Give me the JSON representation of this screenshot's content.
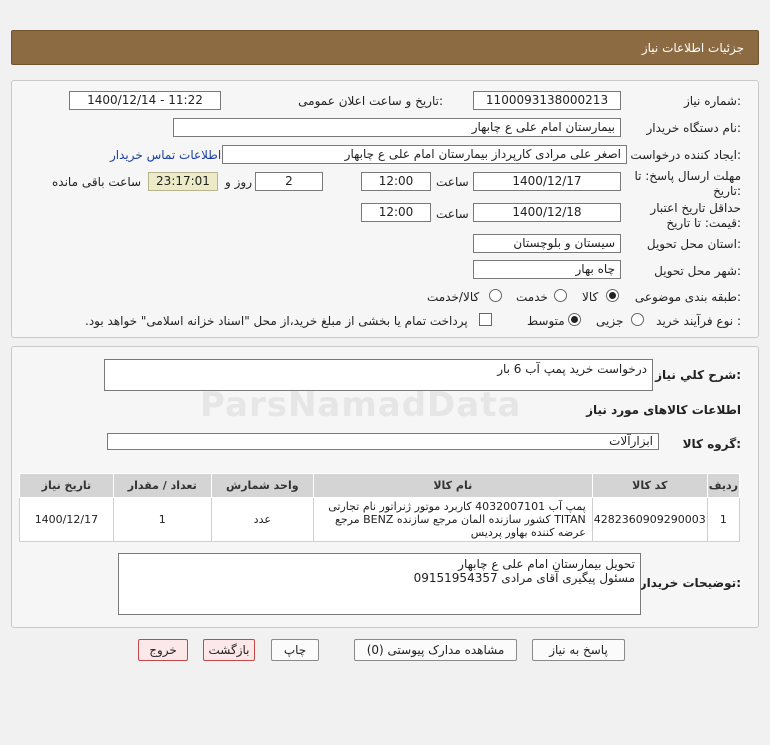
{
  "page_title": "جزئیات اطلاعات نیاز",
  "form": {
    "need_number_label": "شماره نیاز:",
    "need_number": "1100093138000213",
    "announce_label": "تاریخ و ساعت اعلان عمومی:",
    "announce_value": "1400/12/14 - 11:22",
    "buyer_org_label": "نام دستگاه خریدار:",
    "buyer_org": "بیمارستان امام علی  ع  چابهار",
    "requester_label": "ایجاد کننده درخواست:",
    "requester": "اصغر علی مرادی کارپرداز بیمارستان امام علی  ع  چابهار",
    "contact_link": "اطلاعات تماس خریدار",
    "deadline_label_1": "مهلت ارسال پاسخ: تا",
    "deadline_label_2": "تاریخ:",
    "deadline_date": "1400/12/17",
    "time_label": "ساعت",
    "deadline_time": "12:00",
    "days_value": "2",
    "days_label": "روز و",
    "timer": "23:17:01",
    "remaining_label": "ساعت باقی مانده",
    "validity_label_1": "حداقل تاریخ اعتبار",
    "validity_label_2": "قیمت: تا تاریخ:",
    "validity_date": "1400/12/18",
    "validity_time_label": "ساعت",
    "validity_time": "12:00",
    "province_label": "استان محل تحویل:",
    "province": "سیستان و بلوچستان",
    "city_label": "شهر محل تحویل:",
    "city": "چاه بهار",
    "category_label": "طبقه بندی موضوعی:",
    "category_options": [
      "کالا",
      "خدمت",
      "کالا/خدمت"
    ],
    "process_label": "نوع فرآیند خرید :",
    "process_options": [
      "جزیی",
      "متوسط"
    ],
    "payment_note": "پرداخت تمام یا بخشی از مبلغ خرید،از محل \"اسناد خزانه اسلامی\" خواهد بود."
  },
  "summary": {
    "label": "شرح کلي نياز:",
    "value": "درخواست خرید پمپ آب 6 بار"
  },
  "goods_section": {
    "title": "اطلاعات کالاهای مورد نیاز",
    "group_label": "گروه کالا:",
    "group_value": "ابزارآلات"
  },
  "table": {
    "headers": [
      "ردیف",
      "کد کالا",
      "نام کالا",
      "واحد شمارش",
      "تعداد / مقدار",
      "تاریخ نیاز"
    ],
    "rows": [
      {
        "row": "1",
        "code": "4282360909290003",
        "name": "پمپ آب 4032007101 کاربرد موتور ژنراتور نام تجارتی TITAN کشور سازنده المان مرجع سازنده BENZ مرجع عرضه کننده بهاور پردیس",
        "unit": "عدد",
        "qty": "1",
        "date": "1400/12/17"
      }
    ]
  },
  "buyer_notes": {
    "label": "توضیحات خریدار:",
    "line1": "تحویل بیمارستان امام علی ع چابهار",
    "line2": "مسئول پیگیری آقای مرادی 09151954357"
  },
  "buttons": {
    "reply": "پاسخ به نیاز",
    "attachments": "مشاهده مدارک پیوستی (0)",
    "print": "چاپ",
    "back": "بازگشت",
    "exit": "خروج"
  },
  "watermark": "ParsNamadData"
}
